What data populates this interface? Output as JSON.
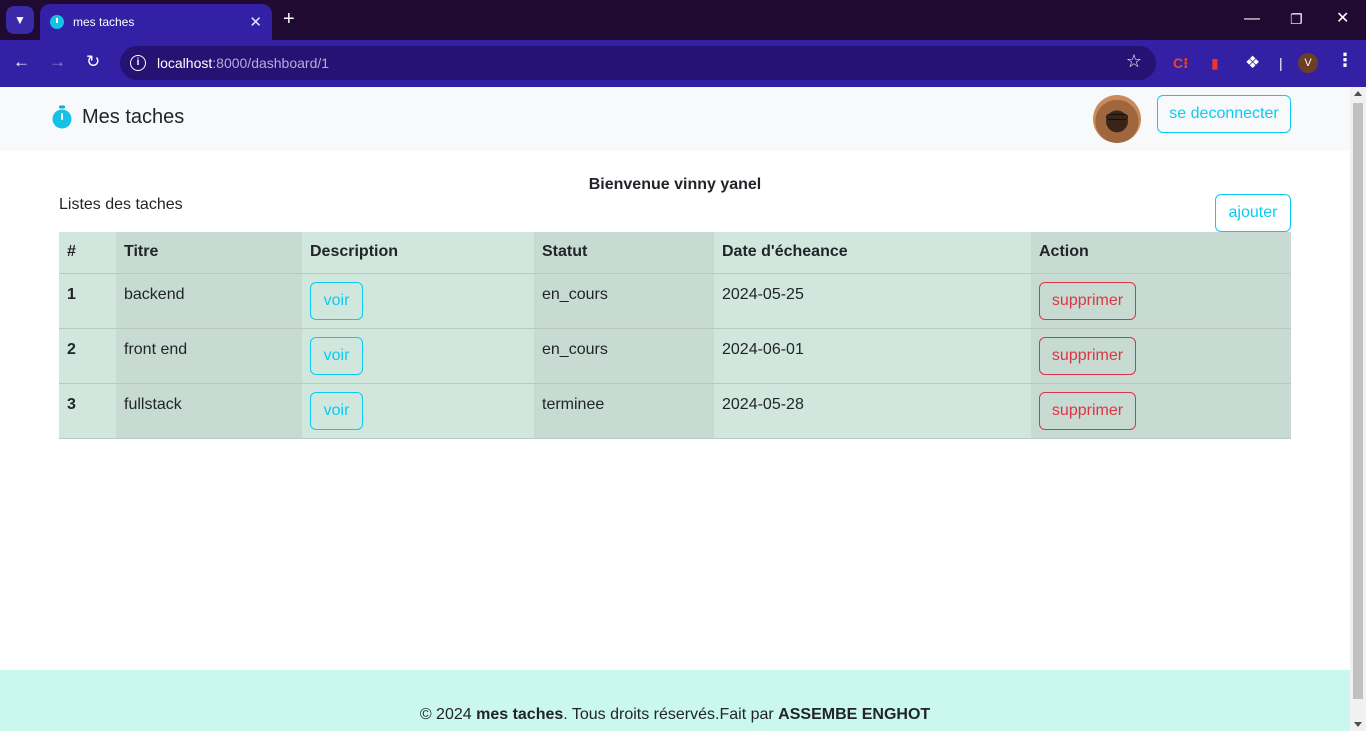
{
  "browser": {
    "tab_title": "mes taches",
    "url_host": "localhost",
    "url_path": ":8000/dashboard/1",
    "profile_initial": "V"
  },
  "navbar": {
    "brand": "Mes taches",
    "logout_label": "se deconnecter"
  },
  "main": {
    "welcome": "Bienvenue vinny yanel",
    "list_title": "Listes des taches",
    "add_label": "ajouter",
    "table": {
      "headers": [
        "#",
        "Titre",
        "Description",
        "Statut",
        "Date d'écheance",
        "Action"
      ],
      "rows": [
        {
          "num": "1",
          "title": "backend",
          "view_label": "voir",
          "status": "en_cours",
          "due": "2024-05-25",
          "delete_label": "supprimer"
        },
        {
          "num": "2",
          "title": "front end",
          "view_label": "voir",
          "status": "en_cours",
          "due": "2024-06-01",
          "delete_label": "supprimer"
        },
        {
          "num": "3",
          "title": "fullstack",
          "view_label": "voir",
          "status": "terminee",
          "due": "2024-05-28",
          "delete_label": "supprimer"
        }
      ]
    }
  },
  "footer": {
    "prefix": "© 2024 ",
    "app": "mes taches",
    "middle": ". Tous droits réservés.Fait par ",
    "author": "ASSEMBE ENGHOT"
  },
  "colors": {
    "accent_info": "#0dcaf0",
    "danger": "#dc3545",
    "table_bg": "#d1e7dd",
    "footer_bg": "#cbf8ee",
    "chrome_bg": "#3320a4"
  }
}
